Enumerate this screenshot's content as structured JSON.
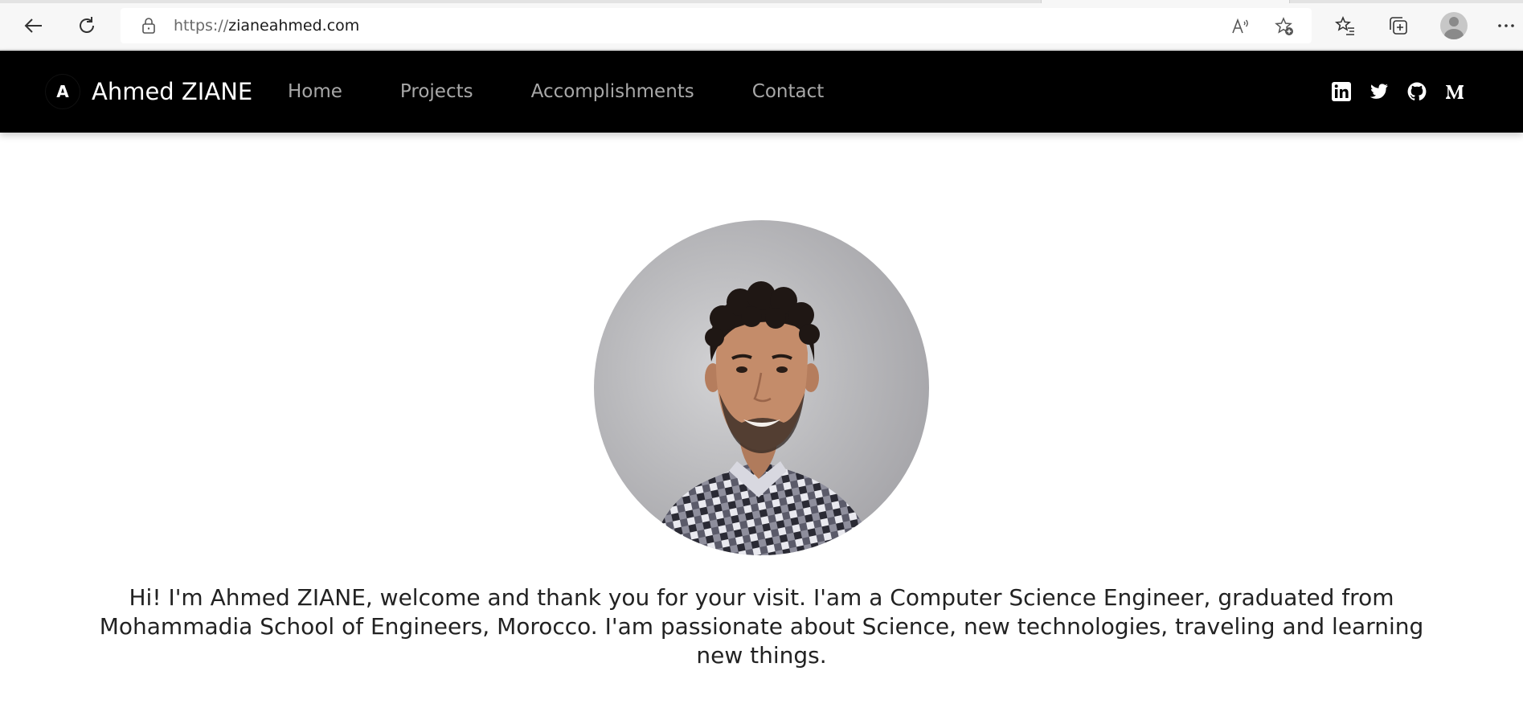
{
  "browser": {
    "url_scheme": "https://",
    "url_host": "zianeahmed.com",
    "icons": [
      "back-icon",
      "refresh-icon",
      "lock-icon",
      "read-aloud-icon",
      "add-favorite-icon",
      "favorites-icon",
      "collections-icon",
      "profile-avatar",
      "more-icon"
    ]
  },
  "navbar": {
    "logo_letter": "A",
    "brand": "Ahmed ZIANE",
    "links": [
      "Home",
      "Projects",
      "Accomplishments",
      "Contact"
    ],
    "social": [
      "linkedin-icon",
      "twitter-icon",
      "github-icon",
      "medium-icon"
    ]
  },
  "hero": {
    "intro": "Hi! I'm Ahmed ZIANE, welcome and thank you for your visit. I'am a Computer Science Engineer, graduated from Mohammadia School of Engineers, Morocco. I'am passionate about Science, new technologies, traveling and learning new things."
  },
  "colors": {
    "navbar_bg": "#000000",
    "nav_link": "#a8a8a8",
    "brand_text": "#ffffff",
    "page_bg": "#ffffff"
  }
}
